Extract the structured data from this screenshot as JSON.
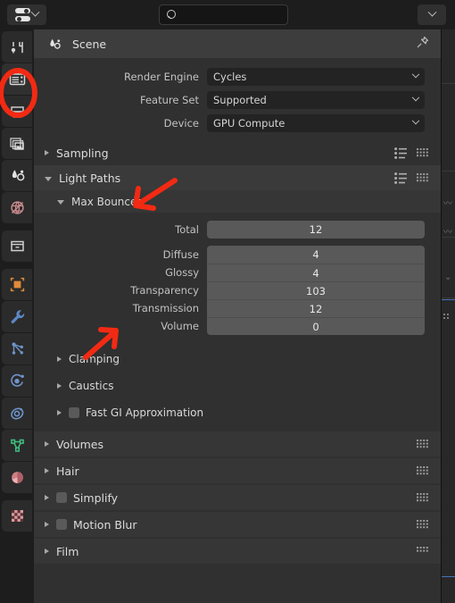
{
  "app": {
    "title": "Blender Properties Editor",
    "accent_red": "#f22a13",
    "bg": "#303030",
    "field_gray": "#595959"
  },
  "topbar": {
    "editor_type_icon": "properties-editor-icon",
    "editor_type_chevron": "chevron-down-icon",
    "search": {
      "value": "",
      "placeholder": "",
      "icon": "search-icon"
    },
    "menu_icon": "chevron-down-icon"
  },
  "tabs": [
    {
      "name": "tool",
      "icon": "tool-icon",
      "active": false
    },
    {
      "name": "render",
      "icon": "render-camera-icon",
      "active": true
    },
    {
      "name": "output",
      "icon": "output-printer-icon",
      "active": false
    },
    {
      "name": "view-layer",
      "icon": "view-layer-images-icon",
      "active": false
    },
    {
      "name": "scene",
      "icon": "scene-cone-icon",
      "active": false
    },
    {
      "name": "world",
      "icon": "world-globe-icon",
      "active": false
    },
    {
      "name": "collection",
      "icon": "collection-box-icon",
      "active": false
    },
    {
      "name": "object",
      "icon": "object-square-icon",
      "active": false
    },
    {
      "name": "modifiers",
      "icon": "wrench-icon",
      "active": false
    },
    {
      "name": "particles",
      "icon": "particles-icon",
      "active": false
    },
    {
      "name": "physics",
      "icon": "physics-orbit-icon",
      "active": false
    },
    {
      "name": "object-constraints",
      "icon": "constraint-icon",
      "active": false
    },
    {
      "name": "object-data",
      "icon": "mesh-data-icon",
      "active": false
    },
    {
      "name": "material",
      "icon": "material-sphere-icon",
      "active": false
    },
    {
      "name": "texture",
      "icon": "texture-checker-icon",
      "active": false
    }
  ],
  "breadcrumb": {
    "icon": "scene-icon",
    "label": "Scene",
    "pin_icon": "pin-icon"
  },
  "render_settings": [
    {
      "label": "Render Engine",
      "value": "Cycles"
    },
    {
      "label": "Feature Set",
      "value": "Supported"
    },
    {
      "label": "Device",
      "value": "GPU Compute"
    }
  ],
  "panels": {
    "sampling": {
      "label": "Sampling",
      "expanded": false,
      "has_preset": true,
      "has_grip": true
    },
    "light_paths": {
      "label": "Light Paths",
      "expanded": true,
      "has_preset": true,
      "has_grip": true
    },
    "max_bounces": {
      "label": "Max Bounces",
      "expanded": true
    }
  },
  "max_bounces": [
    {
      "label": "Total",
      "value": "12"
    },
    {
      "label": "Diffuse",
      "value": "4"
    },
    {
      "label": "Glossy",
      "value": "4"
    },
    {
      "label": "Transparency",
      "value": "103"
    },
    {
      "label": "Transmission",
      "value": "12"
    },
    {
      "label": "Volume",
      "value": "0"
    }
  ],
  "light_path_subpanels": [
    {
      "label": "Clamping",
      "checkbox": false
    },
    {
      "label": "Caustics",
      "checkbox": false
    },
    {
      "label": "Fast GI Approximation",
      "checkbox": true
    }
  ],
  "bottom_panels": [
    {
      "label": "Volumes",
      "checkbox": false,
      "has_grip": true
    },
    {
      "label": "Hair",
      "checkbox": false,
      "has_grip": true
    },
    {
      "label": "Simplify",
      "checkbox": true,
      "has_grip": true
    },
    {
      "label": "Motion Blur",
      "checkbox": true,
      "has_grip": true
    },
    {
      "label": "Film",
      "checkbox": false,
      "has_grip": true
    }
  ],
  "annotations": [
    {
      "name": "arrow-to-light-paths",
      "target": "Light Paths",
      "color": "#f22a13"
    },
    {
      "name": "arrow-to-transparency",
      "target": "Transparency",
      "color": "#f22a13"
    },
    {
      "name": "circle-render-tab",
      "target": "render tab",
      "color": "#f22a13"
    }
  ]
}
